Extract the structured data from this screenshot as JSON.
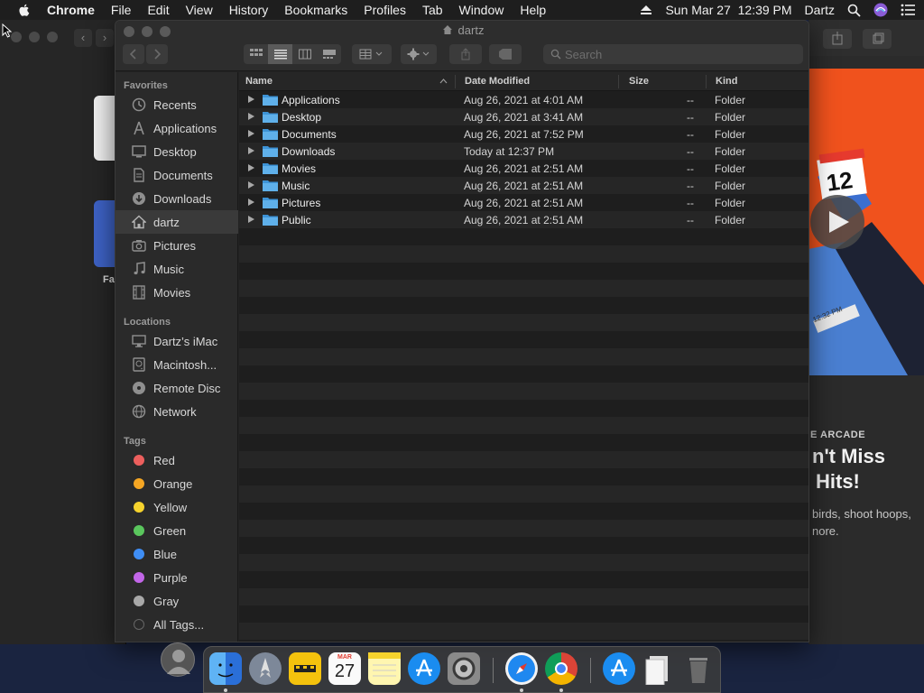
{
  "menubar": {
    "app_name": "Chrome",
    "items": [
      "File",
      "Edit",
      "View",
      "History",
      "Bookmarks",
      "Profiles",
      "Tab",
      "Window",
      "Help"
    ],
    "datetime": "Sun Mar 27  12:39 PM",
    "user": "Dartz"
  },
  "finder": {
    "title": "dartz",
    "search_placeholder": "Search",
    "sidebar": {
      "favorites_title": "Favorites",
      "favorites": [
        {
          "label": "Recents",
          "icon": "clock-icon"
        },
        {
          "label": "Applications",
          "icon": "applications-icon"
        },
        {
          "label": "Desktop",
          "icon": "desktop-icon"
        },
        {
          "label": "Documents",
          "icon": "document-icon"
        },
        {
          "label": "Downloads",
          "icon": "download-icon"
        },
        {
          "label": "dartz",
          "icon": "home-icon",
          "selected": true
        },
        {
          "label": "Pictures",
          "icon": "camera-icon"
        },
        {
          "label": "Music",
          "icon": "music-note-icon"
        },
        {
          "label": "Movies",
          "icon": "film-icon"
        }
      ],
      "locations_title": "Locations",
      "locations": [
        {
          "label": "Dartz’s iMac",
          "icon": "imac-icon"
        },
        {
          "label": "Macintosh...",
          "icon": "disk-icon"
        },
        {
          "label": "Remote Disc",
          "icon": "disc-icon"
        },
        {
          "label": "Network",
          "icon": "globe-icon"
        }
      ],
      "tags_title": "Tags",
      "tags": [
        {
          "label": "Red",
          "color": "#ec5f5d"
        },
        {
          "label": "Orange",
          "color": "#f5a623"
        },
        {
          "label": "Yellow",
          "color": "#f6d32d"
        },
        {
          "label": "Green",
          "color": "#5ac65d"
        },
        {
          "label": "Blue",
          "color": "#3f8ef5"
        },
        {
          "label": "Purple",
          "color": "#c266e8"
        },
        {
          "label": "Gray",
          "color": "#a8a8a8"
        },
        {
          "label": "All Tags...",
          "color": "#555555"
        }
      ]
    },
    "columns": {
      "name": "Name",
      "date_modified": "Date Modified",
      "size": "Size",
      "kind": "Kind"
    },
    "rows": [
      {
        "name": "Applications",
        "date": "Aug 26, 2021 at 4:01 AM",
        "size": "--",
        "kind": "Folder"
      },
      {
        "name": "Desktop",
        "date": "Aug 26, 2021 at 3:41 AM",
        "size": "--",
        "kind": "Folder"
      },
      {
        "name": "Documents",
        "date": "Aug 26, 2021 at 7:52 PM",
        "size": "--",
        "kind": "Folder"
      },
      {
        "name": "Downloads",
        "date": "Today at 12:37 PM",
        "size": "--",
        "kind": "Folder"
      },
      {
        "name": "Movies",
        "date": "Aug 26, 2021 at 2:51 AM",
        "size": "--",
        "kind": "Folder"
      },
      {
        "name": "Music",
        "date": "Aug 26, 2021 at 2:51 AM",
        "size": "--",
        "kind": "Folder"
      },
      {
        "name": "Pictures",
        "date": "Aug 26, 2021 at 2:51 AM",
        "size": "--",
        "kind": "Folder"
      },
      {
        "name": "Public",
        "date": "Aug 26, 2021 at 2:51 AM",
        "size": "--",
        "kind": "Folder"
      }
    ]
  },
  "background_window": {
    "left_label": "Fa",
    "arcade_label": "E ARCADE",
    "headline_line1": "n't Miss",
    "headline_line2": "Hits!",
    "desc_line1": "birds, shoot hoops,",
    "desc_line2": "nore.",
    "hero_calendar_number": "12",
    "hero_time_label": "12:32 PM"
  },
  "dock": {
    "calendar_month": "MAR",
    "calendar_day": "27",
    "apps": [
      "finder-icon",
      "launchpad-icon",
      "taxi-icon",
      "calendar-icon",
      "notes-icon",
      "app-store-icon",
      "system-preferences-icon",
      "safari-icon",
      "chrome-icon",
      "app-store-icon",
      "documents-stack-icon",
      "trash-icon"
    ]
  },
  "colors": {
    "folder_blue": "#4aa3df",
    "hero_orange": "#f0521d",
    "selected_sidebar": "#3a3a3a"
  }
}
